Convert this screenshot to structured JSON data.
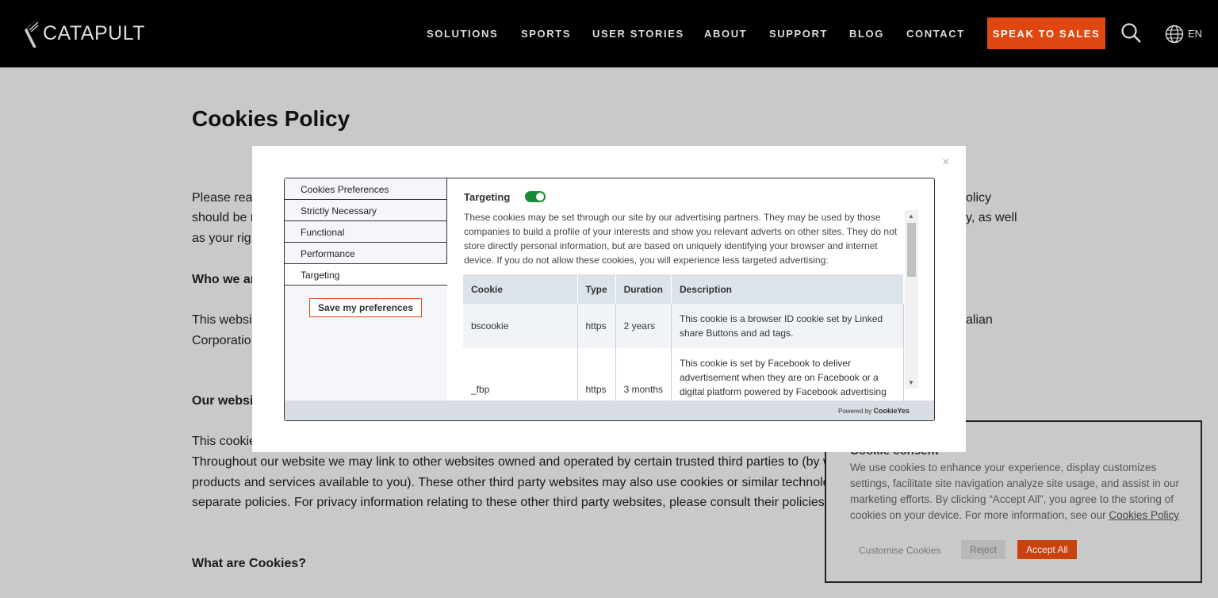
{
  "header": {
    "logo": "CATAPULT",
    "nav": [
      "SOLUTIONS",
      "SPORTS",
      "USER STORIES",
      "ABOUT",
      "SUPPORT",
      "BLOG",
      "CONTACT"
    ],
    "cta": "SPEAK TO SALES",
    "lang": "EN"
  },
  "page": {
    "title": "Cookies Policy",
    "fragments": {
      "p1a": "Please rea",
      "p1b": "should be r",
      "p1c": "as your rig",
      "p1d": "olicy",
      "p1e": "y, as well",
      "h_who": "Who we ar",
      "p2a": "This websi",
      "p2b": "Corporatio",
      "p2c": "alian",
      "h_our": "Our websi",
      "p3a": "This cookie",
      "p3b": "Throughout our website we may link to other websites owned and operated by certain trusted third parties to (by w",
      "p3c": "products and services available to you). These other third party websites may also use cookies or similar technolo",
      "p3d": "separate policies. For privacy information relating to these other third party websites, please consult their policies",
      "h_what": "What are Cookies?"
    }
  },
  "modal": {
    "close": "×",
    "tabs": [
      "Cookies Preferences",
      "Strictly Necessary",
      "Functional",
      "Performance",
      "Targeting"
    ],
    "save": "Save my preferences",
    "section_title": "Targeting",
    "toggle_on": true,
    "description": "These cookies may be set through our site by our advertising partners. They may be used by those companies to build a profile of your interests and show you relevant adverts on other sites. They do not store directly personal information, but are based on uniquely identifying your browser and internet device. If you do not allow these cookies, you will experience less targeted advertising:",
    "columns": [
      "Cookie",
      "Type",
      "Duration",
      "Description"
    ],
    "rows": [
      [
        "bscookie",
        "https",
        "2 years",
        "This cookie is a browser ID cookie set by Linked share Buttons and ad tags."
      ],
      [
        "_fbp",
        "https",
        "3 months",
        "This cookie is set by Facebook to deliver advertisement when they are on Facebook or a digital platform powered by Facebook advertising"
      ]
    ],
    "powered_prefix": "Powered by",
    "powered_brand": "CookieYes"
  },
  "banner": {
    "title": "Cookie consent",
    "text": "We use cookies to enhance your experience, display customizes settings, facilitate site navigation analyze site usage, and assist in our marketing efforts. By clicking “Accept All”, you agree to the storing of cookies on your device. For more information, see our",
    "link": "Cookies Policy",
    "customise": "Customise Cookies",
    "reject": "Reject",
    "accept": "Accept All"
  }
}
